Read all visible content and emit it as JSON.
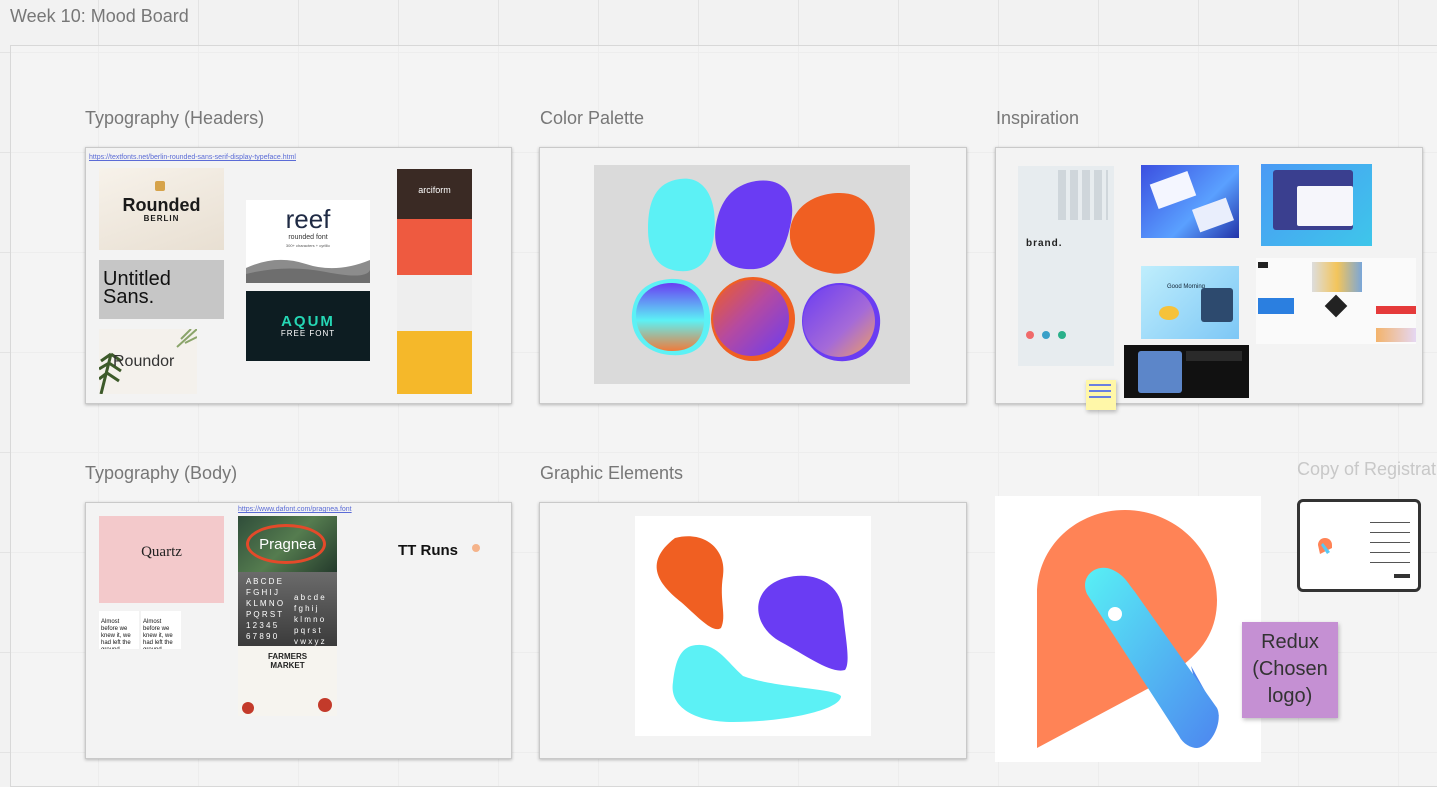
{
  "board": {
    "title": "Week 10: Mood Board"
  },
  "sections": {
    "typography_headers": {
      "title": "Typography (Headers)",
      "link": "https://textfonts.net/berlin-rounded-sans-serif-display-typeface.html",
      "cards": {
        "rounded": {
          "line1": "Rounded",
          "line2": "BERLIN"
        },
        "untitled": {
          "line1": "Untitled",
          "line2": "Sans."
        },
        "roundor": {
          "text": "Roundor"
        },
        "reef": {
          "title": "reef",
          "sub1": "rounded font",
          "sub2": "300+ characters + cyrillic"
        },
        "aqum": {
          "title": "AQUM",
          "sub": "FREE FONT"
        },
        "arciform": {
          "title": "arciform"
        }
      }
    },
    "color_palette": {
      "title": "Color Palette"
    },
    "inspiration": {
      "title": "Inspiration",
      "brand": "brand.",
      "good_morning": "Good Morning"
    },
    "typography_body": {
      "title": "Typography (Body)",
      "link": "https://www.dafont.com/pragnea.font",
      "cards": {
        "quartz": "Quartz",
        "pragnea": "Pragnea",
        "alphabet_upper": "A B C D E\nF G H I J\nK L M N O\nP Q R S T\n1 2 3 4 5\n6 7 8 9 0",
        "alphabet_lower": "a b c d e\nf g h i j\nk l m n o\np q r s t\nv w x y z",
        "farmers": "FARMERS\nMARKET",
        "tt_runs": "TT Runs",
        "sample_1": "Almost before we knew it, we had left the ground.",
        "sample_2": "Almost before we knew it, we had left the ground."
      }
    },
    "graphic_elements": {
      "title": "Graphic Elements"
    },
    "copy_registration": {
      "title": "Copy of Registrat"
    }
  },
  "sticky_note": {
    "text": "Redux (Chosen logo)"
  },
  "colors": {
    "orange": "#f05f22",
    "purple": "#6a3cf3",
    "cyan": "#5cf1f5",
    "logo_orange": "#ff8356",
    "sticky_purple": "#c590d3",
    "sticky_yellow": "#fff7a8"
  }
}
